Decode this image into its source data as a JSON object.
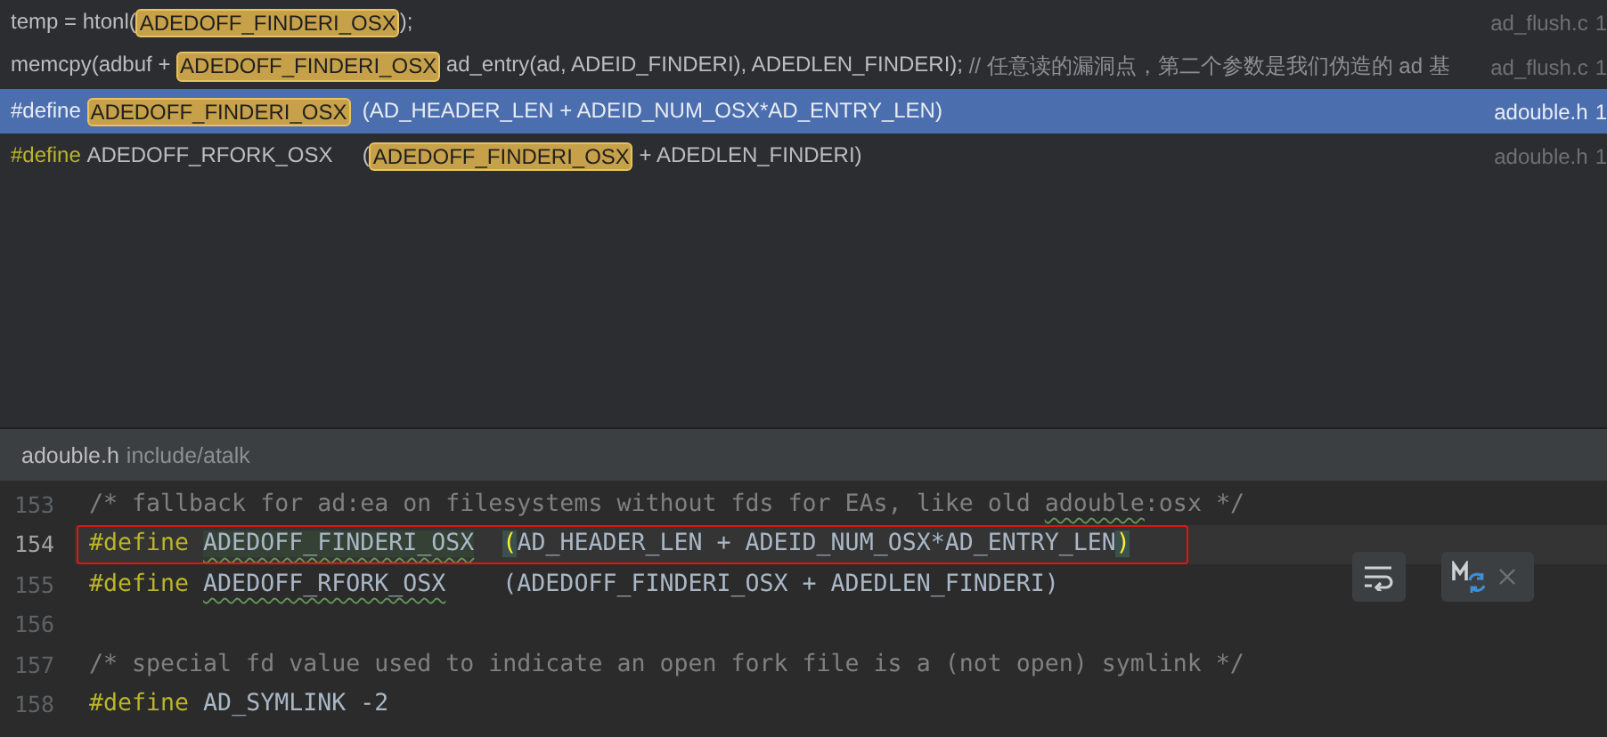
{
  "results": [
    {
      "selected": false,
      "file": "ad_flush.c",
      "line": "1",
      "segments": [
        {
          "kind": "text",
          "text": "temp = htonl("
        },
        {
          "kind": "match",
          "text": "ADEDOFF_FINDERI_OSX"
        },
        {
          "kind": "text",
          "text": ");"
        }
      ]
    },
    {
      "selected": false,
      "file": "ad_flush.c",
      "line": "1",
      "segments": [
        {
          "kind": "text",
          "text": "memcpy(adbuf + "
        },
        {
          "kind": "match",
          "text": "ADEDOFF_FINDERI_OSX"
        },
        {
          "kind": "text",
          "text": " ad_entry(ad, ADEID_FINDERI), ADEDLEN_FINDERI); "
        },
        {
          "kind": "comment",
          "text": "// 任意读的漏洞点，第二个参数是我们伪造的 ad 基"
        }
      ]
    },
    {
      "selected": true,
      "file": "adouble.h",
      "line": "1",
      "segments": [
        {
          "kind": "keyword",
          "text": "#define "
        },
        {
          "kind": "match",
          "text": "ADEDOFF_FINDERI_OSX"
        },
        {
          "kind": "text",
          "text": "  (AD_HEADER_LEN + ADEID_NUM_OSX*AD_ENTRY_LEN)"
        }
      ]
    },
    {
      "selected": false,
      "file": "adouble.h",
      "line": "1",
      "segments": [
        {
          "kind": "keyword",
          "text": "#define "
        },
        {
          "kind": "text",
          "text": "ADEDOFF_RFORK_OSX     ("
        },
        {
          "kind": "match",
          "text": "ADEDOFF_FINDERI_OSX"
        },
        {
          "kind": "text",
          "text": " + ADEDLEN_FINDERI)"
        }
      ]
    }
  ],
  "editor": {
    "file": "adouble.h",
    "path": "include/atalk",
    "lines": [
      {
        "number": "153",
        "current": false,
        "boxed": false,
        "tokens": [
          {
            "kind": "comment",
            "text": "/* fallback for ad:ea on filesystems without fds for EAs, like old "
          },
          {
            "kind": "comment-typo",
            "text": "adouble"
          },
          {
            "kind": "comment",
            "text": ":osx */"
          }
        ]
      },
      {
        "number": "154",
        "current": true,
        "boxed": true,
        "tokens": [
          {
            "kind": "keyword",
            "text": "#define "
          },
          {
            "kind": "macro-current",
            "text": "ADEDOFF_FINDERI_OSX  "
          },
          {
            "kind": "paren-match",
            "text": "("
          },
          {
            "kind": "text",
            "text": "AD_HEADER_LEN + ADEID_NUM_OSX*AD_ENTRY_LEN"
          },
          {
            "kind": "paren-match",
            "text": ")"
          }
        ]
      },
      {
        "number": "155",
        "current": false,
        "boxed": false,
        "tokens": [
          {
            "kind": "keyword",
            "text": "#define "
          },
          {
            "kind": "macro",
            "text": "ADEDOFF_RFORK_OSX"
          },
          {
            "kind": "text",
            "text": "    (ADEDOFF_FINDERI_OSX + ADEDLEN_FINDERI)"
          }
        ]
      },
      {
        "number": "156",
        "current": false,
        "boxed": false
      },
      {
        "number": "157",
        "current": false,
        "boxed": false,
        "tokens": [
          {
            "kind": "comment",
            "text": "/* special fd value used to indicate an open fork file is a (not open) symlink */"
          }
        ]
      },
      {
        "number": "158",
        "current": false,
        "boxed": false,
        "tokens": [
          {
            "kind": "keyword",
            "text": "#define"
          },
          {
            "kind": "text",
            "text": " AD_SYMLINK -2"
          }
        ]
      }
    ]
  }
}
